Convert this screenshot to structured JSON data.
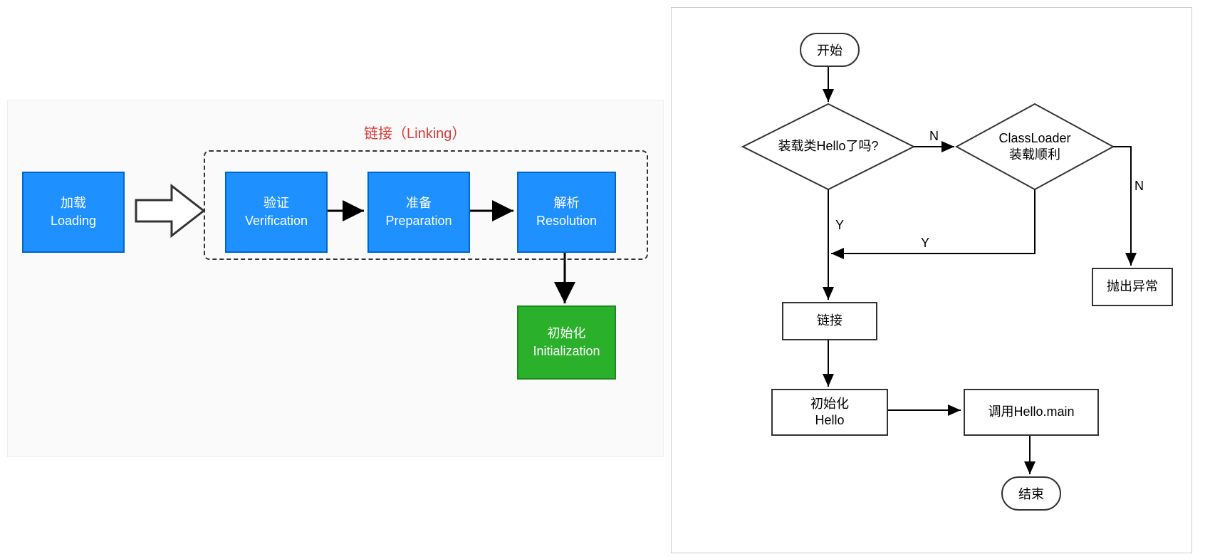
{
  "left": {
    "linking_title": "链接（Linking）",
    "loading": {
      "cn": "加载",
      "en": "Loading"
    },
    "verification": {
      "cn": "验证",
      "en": "Verification"
    },
    "preparation": {
      "cn": "准备",
      "en": "Preparation"
    },
    "resolution": {
      "cn": "解析",
      "en": "Resolution"
    },
    "initialization": {
      "cn": "初始化",
      "en": "Initialization"
    }
  },
  "right": {
    "start": "开始",
    "decision_loaded": "装载类Hello了吗?",
    "decision_classloader_cn": "ClassLoader",
    "decision_classloader_sub": "装载顺利",
    "throw_exception": "抛出异常",
    "link": "链接",
    "init_cn": "初始化",
    "init_sub": "Hello",
    "call_main": "调用Hello.main",
    "end": "结束",
    "label_Y": "Y",
    "label_N": "N"
  }
}
